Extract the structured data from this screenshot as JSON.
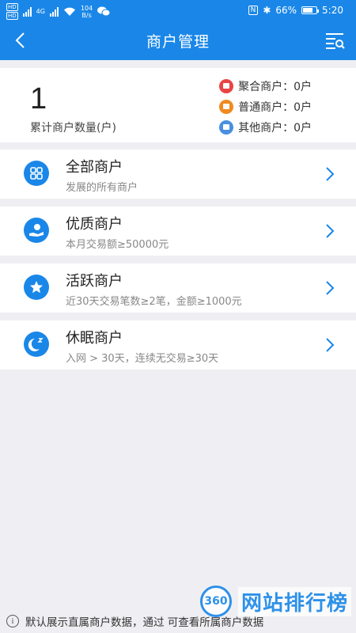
{
  "status_bar": {
    "hd_top": "HD",
    "hd_bottom": "HD",
    "network_4g": "4G",
    "net_speed_value": "104",
    "net_speed_unit": "B/s",
    "nfc": "N",
    "bluetooth": "✱",
    "battery_percent": "66%",
    "time": "5:20"
  },
  "nav": {
    "title": "商户管理"
  },
  "summary": {
    "count": "1",
    "count_label": "累计商户数量(户)",
    "legend": [
      {
        "label": "聚合商户：0户",
        "color": "#e84545"
      },
      {
        "label": "普通商户：0户",
        "color": "#ef8b1f"
      },
      {
        "label": "其他商户：0户",
        "color": "#4a8fe0"
      }
    ]
  },
  "cards": [
    {
      "title": "全部商户",
      "subtitle": "发展的所有商户",
      "icon": "grid-icon"
    },
    {
      "title": "优质商户",
      "subtitle": "本月交易额≥50000元",
      "icon": "money-hand-icon"
    },
    {
      "title": "活跃商户",
      "subtitle": "近30天交易笔数≥2笔，金额≥1000元",
      "icon": "star-icon"
    },
    {
      "title": "休眠商户",
      "subtitle": "入网 > 30天，连续无交易≥30天",
      "icon": "moon-sleep-icon"
    }
  ],
  "footer": {
    "note": "默认展示直属商户数据，通过      可查看所属商户数据"
  },
  "watermark": {
    "badge": "360",
    "text": "网站排行榜"
  },
  "colors": {
    "brand": "#1a87e8",
    "background": "#efeff3"
  }
}
